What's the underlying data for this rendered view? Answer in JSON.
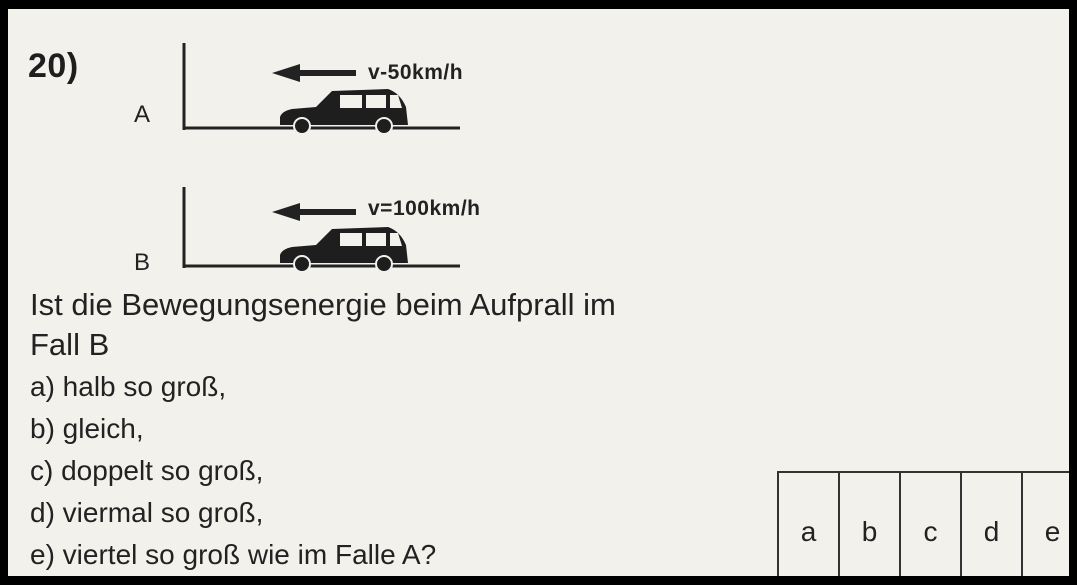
{
  "question": {
    "number": "20)",
    "text_line1": "Ist die Bewegungsenergie beim Aufprall im",
    "text_line2": "Fall B"
  },
  "diagrams": [
    {
      "label": "A",
      "speed": "v-50km/h"
    },
    {
      "label": "B",
      "speed": "v=100km/h"
    }
  ],
  "options": [
    "a) halb so groß,",
    "b) gleich,",
    "c) doppelt so groß,",
    "d) viermal so groß,",
    "e) viertel so groß wie im Falle A?"
  ],
  "answer_cells": [
    "a",
    "b",
    "c",
    "d",
    "e"
  ]
}
